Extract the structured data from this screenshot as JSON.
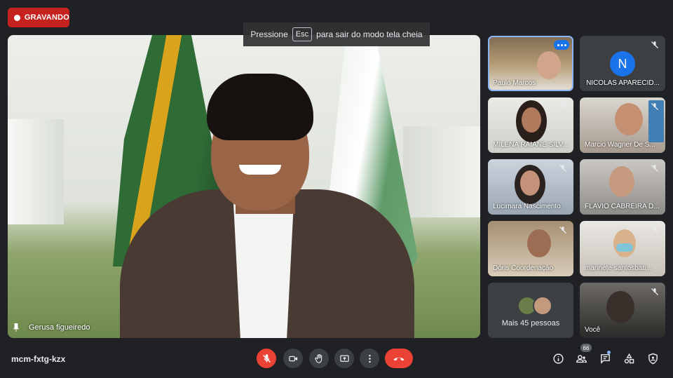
{
  "recording": {
    "label": "GRAVANDO"
  },
  "fullscreen_banner": {
    "before": "Pressione",
    "key": "Esc",
    "after": "para sair do modo tela cheia"
  },
  "main_video": {
    "name": "Gerusa figueiredo"
  },
  "participants": [
    {
      "name": "Paulo Marcos",
      "muted": false,
      "selected": true
    },
    {
      "name": "NICOLAS APARECID...",
      "muted": true,
      "avatar_letter": "N"
    },
    {
      "name": "MILENA RAIANE SILV...",
      "muted": true
    },
    {
      "name": "Marcio Wagner De S...",
      "muted": true
    },
    {
      "name": "Lucimara Nascimento",
      "muted": true
    },
    {
      "name": "FLAVIO CABREIRA D...",
      "muted": true
    },
    {
      "name": "Dóris Coordenação",
      "muted": true
    },
    {
      "name": "marinete santosbati...",
      "muted": true
    },
    {
      "name": "Você",
      "muted": true
    }
  ],
  "more_people": {
    "label": "Mais 45 pessoas"
  },
  "meeting": {
    "code": "mcm-fxtg-kzx",
    "participant_count": "66"
  },
  "colors": {
    "accent": "#1a73e8",
    "danger": "#ea4335",
    "background": "#202124",
    "tile": "#3c4043"
  },
  "icons": {
    "controls": [
      "mic-off-icon",
      "camera-icon",
      "raise-hand-icon",
      "present-screen-icon",
      "more-options-icon",
      "hang-up-icon"
    ],
    "right": [
      "info-icon",
      "people-icon",
      "chat-icon",
      "activities-icon",
      "host-controls-icon"
    ]
  }
}
